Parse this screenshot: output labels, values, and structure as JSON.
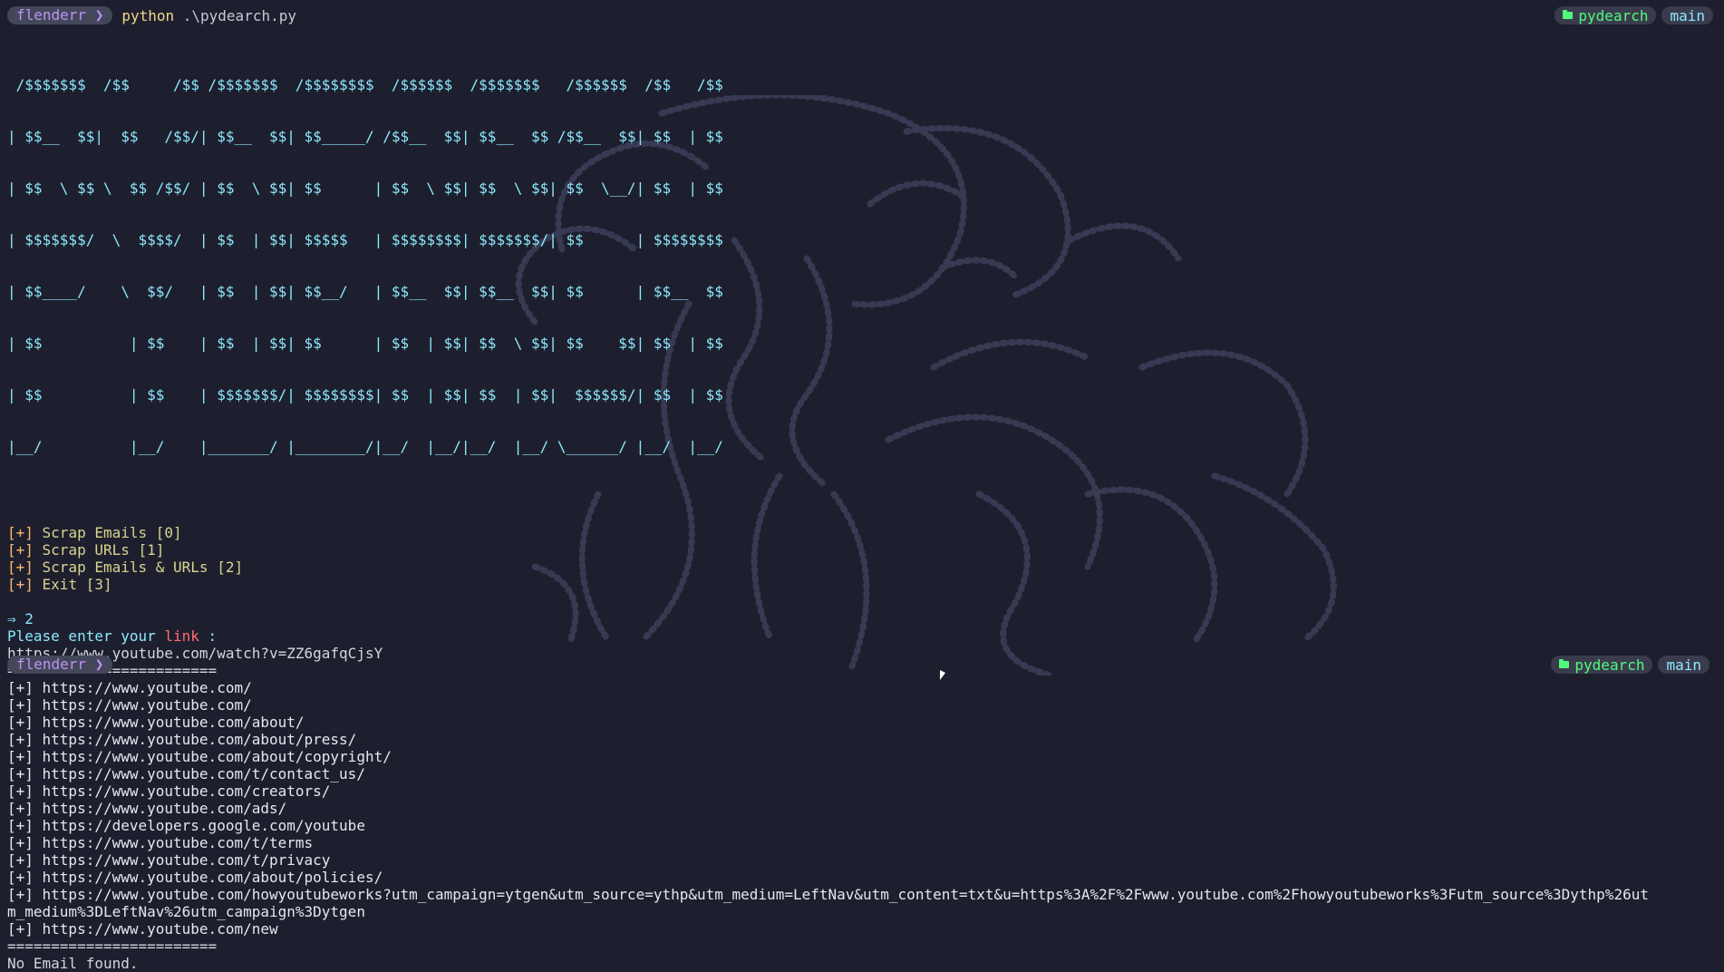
{
  "top_bar": {
    "user": "flenderr ❯",
    "command_py": "python",
    "command_arg": " .\\pydearch.py",
    "repo": "pydearch",
    "branch": "main"
  },
  "banner_lines": [
    " /$$$$$$$  /$$     /$$ /$$$$$$$  /$$$$$$$$  /$$$$$$  /$$$$$$$   /$$$$$$  /$$   /$$",
    "| $$__  $$|  $$   /$$/| $$__  $$| $$_____/ /$$__  $$| $$__  $$ /$$__  $$| $$  | $$",
    "| $$  \\ $$ \\  $$ /$$/ | $$  \\ $$| $$      | $$  \\ $$| $$  \\ $$| $$  \\__/| $$  | $$",
    "| $$$$$$$/  \\  $$$$/  | $$  | $$| $$$$$   | $$$$$$$$| $$$$$$$/| $$      | $$$$$$$$",
    "| $$____/    \\  $$/   | $$  | $$| $$__/   | $$__  $$| $$__  $$| $$      | $$__  $$",
    "| $$          | $$    | $$  | $$| $$      | $$  | $$| $$  \\ $$| $$    $$| $$  | $$",
    "| $$          | $$    | $$$$$$$/| $$$$$$$$| $$  | $$| $$  | $$|  $$$$$$/| $$  | $$",
    "|__/          |__/    |_______/ |________/|__/  |__/|__/  |__/ \\______/ |__/  |__/"
  ],
  "menu": [
    {
      "bracket": "[+]",
      "text": " Scrap Emails [0]"
    },
    {
      "bracket": "[+]",
      "text": " Scrap URLs [1]"
    },
    {
      "bracket": "[+]",
      "text": " Scrap Emails & URLs [2]"
    },
    {
      "bracket": "[+]",
      "text": " Exit [3]"
    }
  ],
  "input_choice": "⇒ 2",
  "ask": {
    "prefix": "Please enter your ",
    "keyword": "link",
    "suffix": " :"
  },
  "entered_link": "https://www.youtube.com/watch?v=ZZ6gafqCjsY",
  "separator": "========================",
  "urls": [
    "[+] https://www.youtube.com/",
    "[+] https://www.youtube.com/",
    "[+] https://www.youtube.com/about/",
    "[+] https://www.youtube.com/about/press/",
    "[+] https://www.youtube.com/about/copyright/",
    "[+] https://www.youtube.com/t/contact_us/",
    "[+] https://www.youtube.com/creators/",
    "[+] https://www.youtube.com/ads/",
    "[+] https://developers.google.com/youtube",
    "[+] https://www.youtube.com/t/terms",
    "[+] https://www.youtube.com/t/privacy",
    "[+] https://www.youtube.com/about/policies/",
    "[+] https://www.youtube.com/howyoutubeworks?utm_campaign=ytgen&utm_source=ythp&utm_medium=LeftNav&utm_content=txt&u=https%3A%2F%2Fwww.youtube.com%2Fhowyoutubeworks%3Futm_source%3Dythp%26ut",
    "m_medium%3DLeftNav%26utm_campaign%3Dytgen",
    "[+] https://www.youtube.com/new"
  ],
  "result": "No Email found.",
  "bottom_bar": {
    "user": "flenderr ❯",
    "repo": "pydearch",
    "branch": "main"
  },
  "colors": {
    "background": "#1e1f2e",
    "banner": "#8be9fd",
    "menu": "#d8d48f",
    "prompt": "#bd93f9"
  }
}
